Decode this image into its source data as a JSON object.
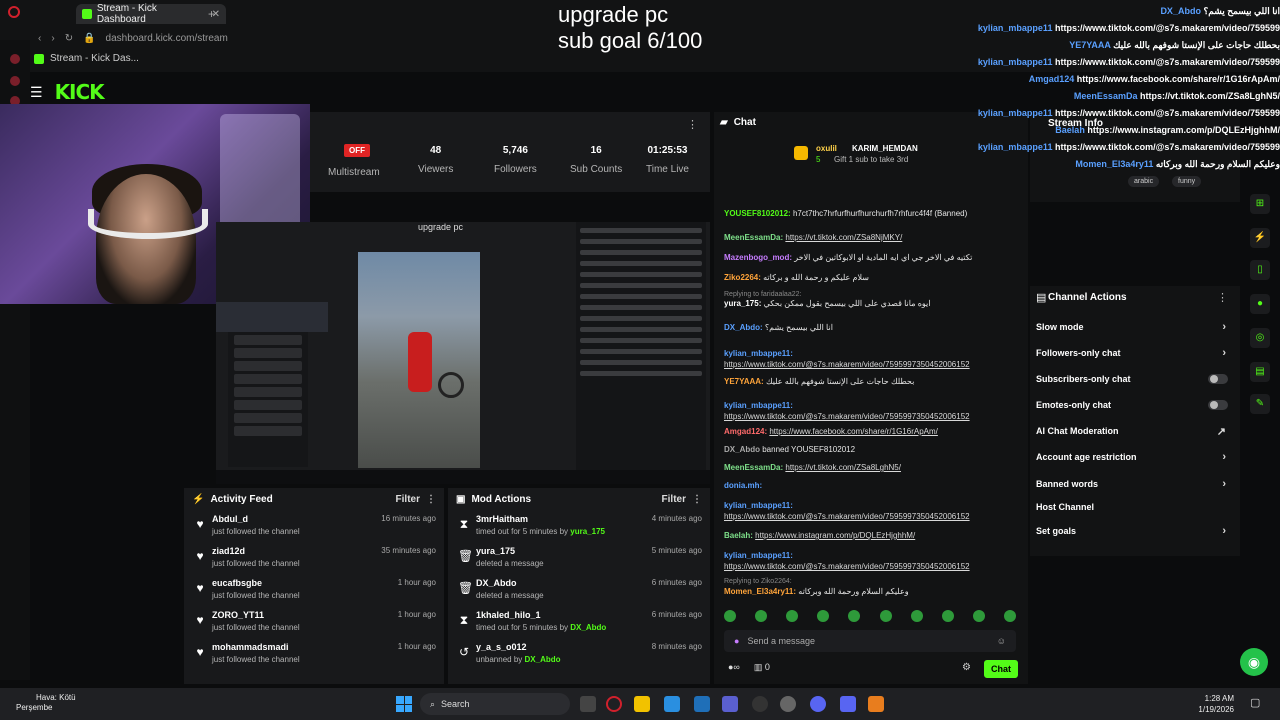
{
  "browser": {
    "tab_title": "Stream - Kick Dashboard",
    "url": "dashboard.kick.com/stream",
    "breadcrumb": "Stream - Kick Das..."
  },
  "overlay": {
    "line1": "upgrade pc",
    "line2": "sub goal 6/100"
  },
  "header": {
    "logo": "KICK"
  },
  "stats": {
    "status": "OFF",
    "status_label": "Multistream",
    "viewers": "48",
    "viewers_label": "Viewers",
    "followers": "5,746",
    "followers_label": "Followers",
    "subs": "16",
    "subs_label": "Sub Counts",
    "time": "01:25:53",
    "time_label": "Time Live"
  },
  "preview": {
    "title": "upgrade pc"
  },
  "activity": {
    "title": "Activity Feed",
    "filter": "Filter",
    "items": [
      {
        "name": "Abdul_d",
        "desc": "just followed the channel",
        "time": "16 minutes ago"
      },
      {
        "name": "ziad12d",
        "desc": "just followed the channel",
        "time": "35 minutes ago"
      },
      {
        "name": "eucafbsgbe",
        "desc": "just followed the channel",
        "time": "1 hour ago"
      },
      {
        "name": "ZORO_YT11",
        "desc": "just followed the channel",
        "time": "1 hour ago"
      },
      {
        "name": "mohammadsmadi",
        "desc": "just followed the channel",
        "time": "1 hour ago"
      }
    ]
  },
  "mod_actions": {
    "title": "Mod Actions",
    "filter": "Filter",
    "items": [
      {
        "name": "3mrHaitham",
        "desc": "timed out for 5 minutes by",
        "by": "yura_175",
        "time": "4 minutes ago"
      },
      {
        "name": "yura_175",
        "desc": "deleted a message",
        "by": "",
        "time": "5 minutes ago"
      },
      {
        "name": "DX_Abdo",
        "desc": "deleted a message",
        "by": "",
        "time": "6 minutes ago"
      },
      {
        "name": "1khaled_hilo_1",
        "desc": "timed out for 5 minutes by",
        "by": "DX_Abdo",
        "time": "6 minutes ago"
      },
      {
        "name": "y_a_s_o012",
        "desc": "unbanned by",
        "by": "DX_Abdo",
        "time": "8 minutes ago"
      }
    ]
  },
  "chat": {
    "title": "Chat",
    "pinned_user": "oxulil",
    "pinned_target": "KARIM_HEMDAN",
    "pinned_count": "5",
    "pinned_text": "Gift 1 sub to take 3rd",
    "messages": [
      {
        "user": "YOUSEF8102012:",
        "text": "h7ct7thc7hrfurfhurfhurchurfh7rhfurc4f4f (Banned)",
        "color": "#53fc18"
      },
      {
        "user": "MeenEssamDa:",
        "text": "https://vt.tiktok.com/ZSa8NjMKY/",
        "color": "#7ee08a"
      },
      {
        "user": "Mazenbogo_mod:",
        "text": "تكتيه في الاخر جي اي ايه المادية او الابوكاتين في الاخر",
        "color": "#c77dff"
      },
      {
        "user": "Ziko2264:",
        "text": "سلام عليكم و رحمة الله و بركاته",
        "color": "#ffa43a"
      },
      {
        "user": "yura_175:",
        "text": "ايوه مانا قصدي على اللي بيسمح بقول ممكن بحكي",
        "color": "#fff"
      },
      {
        "user": "DX_Abdo:",
        "text": "انا اللي بيسمح يشم؟",
        "color": "#5aa0ff"
      },
      {
        "user": "kylian_mbappe11:",
        "text": "https://www.tiktok.com/@s7s.makarem/video/7595997350452006152",
        "color": "#5aa0ff"
      },
      {
        "user": "YE7YAAA:",
        "text": "بحطلك حاجات على الإنستا شوفهم بالله عليك",
        "color": "#ffa43a"
      },
      {
        "user": "kylian_mbappe11:",
        "text": "https://www.tiktok.com/@s7s.makarem/video/7595997350452006152",
        "color": "#5aa0ff"
      },
      {
        "user": "Amgad124:",
        "text": "https://www.facebook.com/share/r/1G16rApAm/",
        "color": "#ff6b6b"
      },
      {
        "user": "DX_Abdo",
        "text": "banned YOUSEF8102012",
        "color": "#aaa"
      },
      {
        "user": "MeenEssamDa:",
        "text": "https://vt.tiktok.com/ZSa8LghN5/",
        "color": "#7ee08a"
      },
      {
        "user": "donia.mh:",
        "text": "",
        "color": "#5aa0ff"
      },
      {
        "user": "kylian_mbappe11:",
        "text": "https://www.tiktok.com/@s7s.makarem/video/7595997350452006152",
        "color": "#5aa0ff"
      },
      {
        "user": "Baelah:",
        "text": "https://www.instagram.com/p/DQLEzHjghhM/",
        "color": "#7ee08a"
      },
      {
        "user": "kylian_mbappe11:",
        "text": "https://www.tiktok.com/@s7s.makarem/video/7595997350452006152",
        "color": "#5aa0ff"
      },
      {
        "user": "Momen_El3a4ry11:",
        "text": "وعليكم السلام ورحمة الله وبركاته",
        "color": "#ffa43a"
      }
    ],
    "reply1": "Replying to faridaalaa22:",
    "reply2": "Replying to Ziko2264:",
    "input_placeholder": "Send a message",
    "send_label": "Chat",
    "footer_count": "0"
  },
  "stream_info": {
    "title": "Stream Info",
    "tags": [
      "arabic",
      "funny"
    ]
  },
  "channel_actions": {
    "title": "Channel Actions",
    "items": [
      {
        "label": "Slow mode",
        "kind": "chevron"
      },
      {
        "label": "Followers-only chat",
        "kind": "chevron"
      },
      {
        "label": "Subscribers-only chat",
        "kind": "toggle"
      },
      {
        "label": "Emotes-only chat",
        "kind": "toggle"
      },
      {
        "label": "AI Chat Moderation",
        "kind": "external"
      },
      {
        "label": "Account age restriction",
        "kind": "chevron"
      },
      {
        "label": "Banned words",
        "kind": "chevron"
      },
      {
        "label": "Host Channel",
        "kind": "none"
      },
      {
        "label": "Set goals",
        "kind": "chevron"
      }
    ]
  },
  "overlay_chat": [
    {
      "user": "DX_Abdo",
      "text": "انا اللي بيسمح يشم؟"
    },
    {
      "user": "kylian_mbappe11",
      "text": "https://www.tiktok.com/@s7s.makarem/video/759599"
    },
    {
      "user": "YE7YAAA",
      "text": "بحطلك حاجات على الإنستا شوفهم بالله عليك"
    },
    {
      "user": "kylian_mbappe11",
      "text": "https://www.tiktok.com/@s7s.makarem/video/759599"
    },
    {
      "user": "Amgad124",
      "text": "https://www.facebook.com/share/r/1G16rApAm/"
    },
    {
      "user": "MeenEssamDa",
      "text": "https://vt.tiktok.com/ZSa8LghN5/"
    },
    {
      "user": "kylian_mbappe11",
      "text": "https://www.tiktok.com/@s7s.makarem/video/759599"
    },
    {
      "user": "Baelah",
      "text": "https://www.instagram.com/p/DQLEzHjghhM/"
    },
    {
      "user": "kylian_mbappe11",
      "text": "https://www.tiktok.com/@s7s.makarem/video/759599"
    },
    {
      "user": "Momen_El3a4ry11",
      "text": "وعليكم السلام ورحمة الله وبركاته"
    }
  ],
  "taskbar": {
    "weather_title": "Hava: Kötü",
    "weather_day": "Perşembe",
    "search": "Search",
    "time": "1:28 AM",
    "date": "1/19/2026"
  },
  "colors": {
    "accent": "#53fc18",
    "off": "#e02424"
  }
}
